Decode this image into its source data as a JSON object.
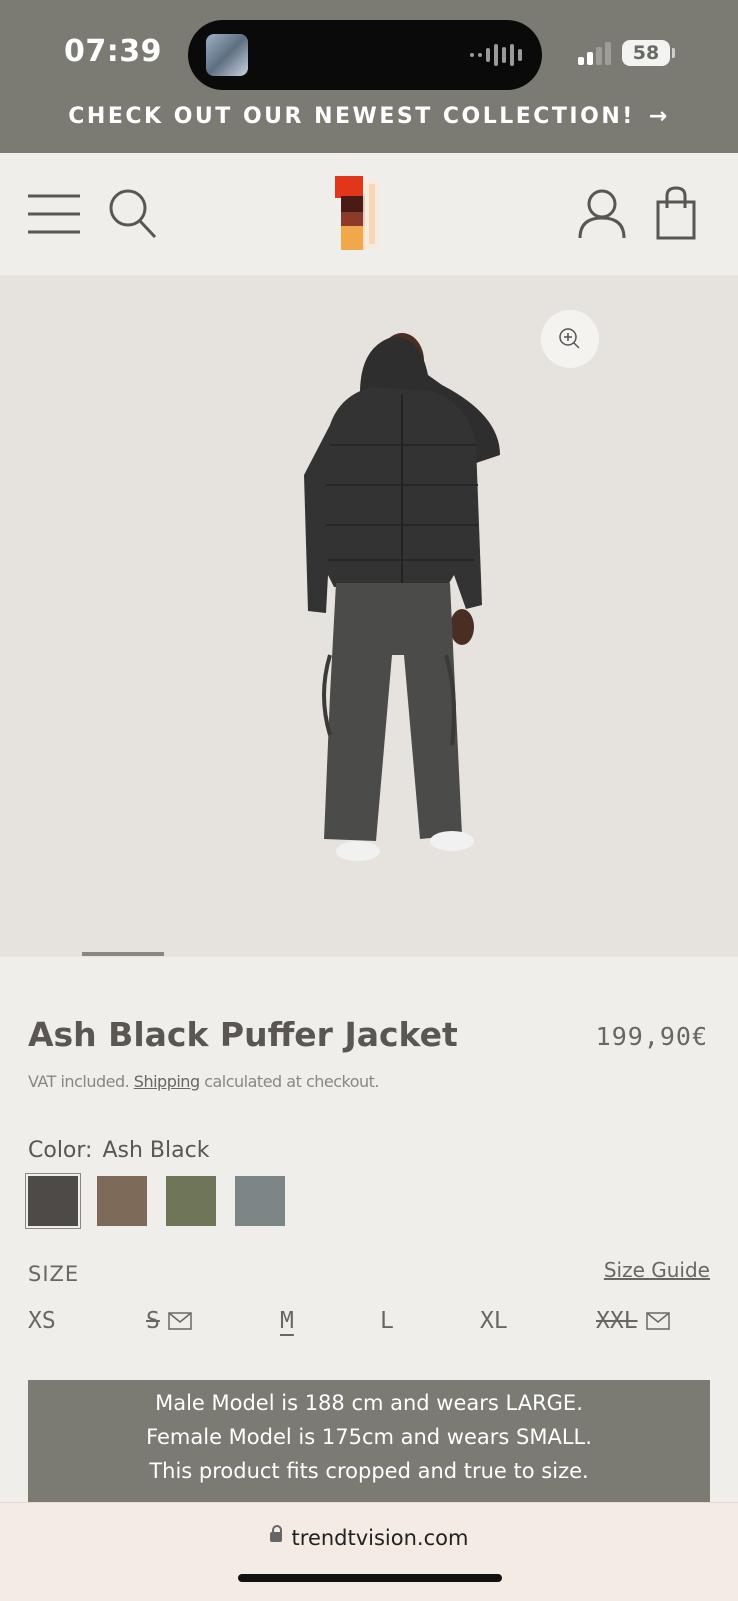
{
  "status_bar": {
    "time": "07:39",
    "battery": "58"
  },
  "promo": {
    "text": "CHECK OUT OUR NEWEST COLLECTION!",
    "arrow": "→"
  },
  "header": {
    "icons": [
      "menu-icon",
      "search-icon",
      "brand-logo",
      "account-icon",
      "cart-icon"
    ]
  },
  "product": {
    "title": "Ash Black Puffer Jacket",
    "price": "199,90€",
    "vat_prefix": "VAT included.",
    "shipping_link": "Shipping",
    "vat_suffix": "calculated at checkout.",
    "color_label": "Color:",
    "color_value": "Ash Black",
    "swatches": [
      {
        "name": "Ash Black",
        "hex": "#4e4a48",
        "selected": true
      },
      {
        "name": "Brown",
        "hex": "#7e6a59",
        "selected": false
      },
      {
        "name": "Olive",
        "hex": "#6f7558",
        "selected": false
      },
      {
        "name": "Grey",
        "hex": "#7c8686",
        "selected": false
      }
    ],
    "size_label": "SIZE",
    "size_guide": "Size Guide",
    "sizes": [
      {
        "label": "XS",
        "state": "available",
        "notify": false
      },
      {
        "label": "S",
        "state": "soldout",
        "notify": true
      },
      {
        "label": "M",
        "state": "selected",
        "notify": false
      },
      {
        "label": "L",
        "state": "available",
        "notify": false
      },
      {
        "label": "XL",
        "state": "available",
        "notify": false
      },
      {
        "label": "XXL",
        "state": "soldout",
        "notify": true
      }
    ],
    "fit_lines": [
      "Male Model is 188 cm and wears LARGE.",
      "Female Model is 175cm and wears SMALL.",
      "This product fits cropped and true to size."
    ]
  },
  "browser": {
    "url": "trendtvision.com"
  }
}
